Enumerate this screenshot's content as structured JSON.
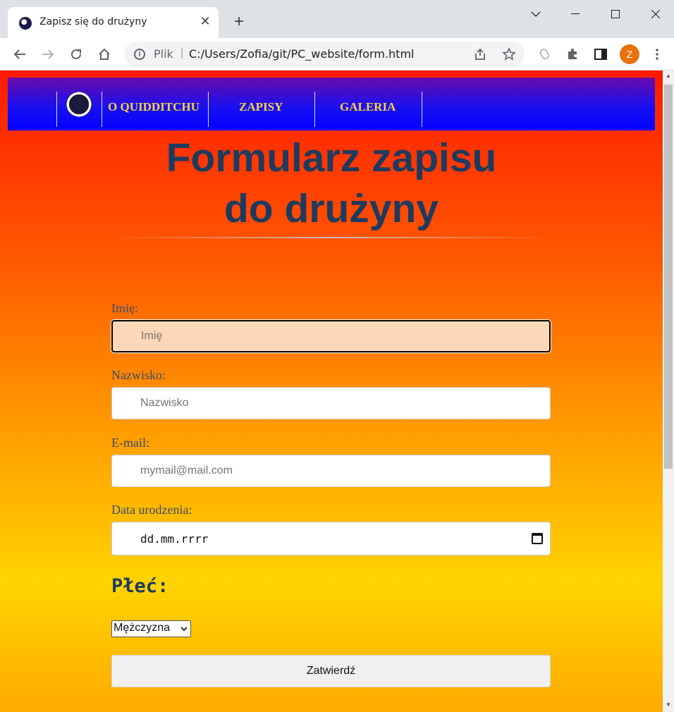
{
  "browser": {
    "tab_title": "Zapisz się do drużyny",
    "tab_close": "✕",
    "new_tab": "+",
    "omnibox_scheme": "Plik",
    "omnibox_separator": "|",
    "url": "C:/Users/Zofia/git/PC_website/form.html",
    "profile_initial": "Z",
    "profile_color": "#e8710a"
  },
  "nav": {
    "links": [
      "O QUIDDITCHU",
      "ZAPISY",
      "GALERIA"
    ],
    "link_color": "#ffd23c"
  },
  "page": {
    "title": "Formularz zapisu do drużyny",
    "title_color": "#1e3a5f"
  },
  "form": {
    "first_name": {
      "label": "Imię:",
      "placeholder": "Imię",
      "value": ""
    },
    "last_name": {
      "label": "Nazwisko:",
      "placeholder": "Nazwisko",
      "value": ""
    },
    "email": {
      "label": "E-mail:",
      "placeholder": "mymail@mail.com",
      "value": ""
    },
    "birth_date": {
      "label": "Data urodzenia:",
      "placeholder": "dd.mm.rrrr"
    },
    "gender": {
      "heading": "Płeć:",
      "selected": "Mężczyzna"
    },
    "submit_label": "Zatwierdź"
  }
}
